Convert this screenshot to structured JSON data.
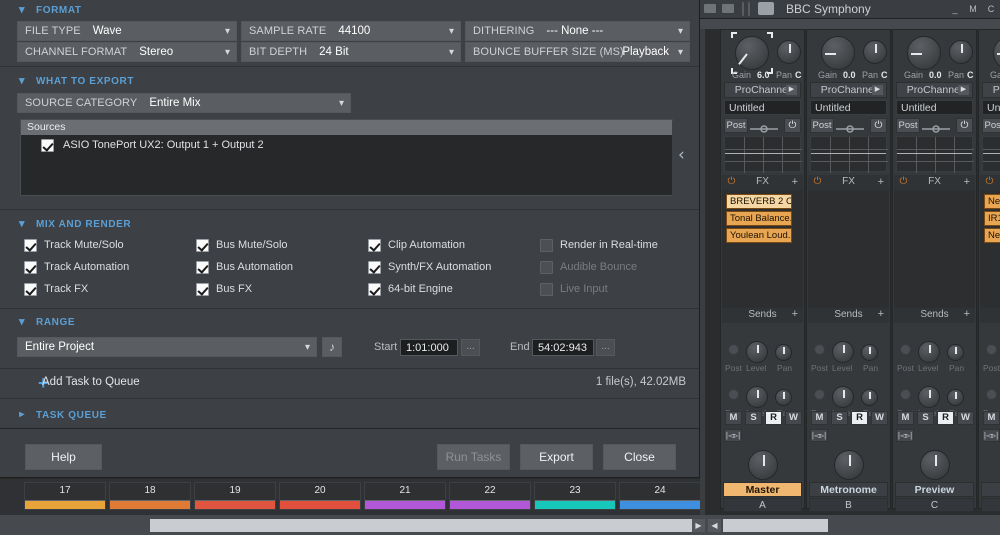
{
  "host": {
    "title": "BBC Symphony",
    "window_buttons": [
      "_",
      "M",
      "C"
    ]
  },
  "dialog": {
    "sections": {
      "format": {
        "title": "FORMAT",
        "fields": [
          {
            "label": "FILE TYPE",
            "value": "Wave"
          },
          {
            "label": "CHANNEL FORMAT",
            "value": "Stereo"
          },
          {
            "label": "SAMPLE RATE",
            "value": "44100"
          },
          {
            "label": "BIT DEPTH",
            "value": "24 Bit"
          },
          {
            "label": "DITHERING",
            "value": "--- None ---"
          },
          {
            "label": "BOUNCE BUFFER SIZE (MS)",
            "value": "Playback"
          }
        ]
      },
      "what_to_export": {
        "title": "WHAT TO EXPORT",
        "source_category": {
          "label": "SOURCE CATEGORY",
          "value": "Entire Mix"
        },
        "sources_header": "Sources",
        "sources": [
          {
            "label": "ASIO TonePort UX2: Output 1 + Output 2",
            "checked": true
          }
        ]
      },
      "mix_and_render": {
        "title": "MIX AND RENDER",
        "options": [
          {
            "label": "Track Mute/Solo",
            "checked": true,
            "enabled": true
          },
          {
            "label": "Track Automation",
            "checked": true,
            "enabled": true
          },
          {
            "label": "Track FX",
            "checked": true,
            "enabled": true
          },
          {
            "label": "Bus Mute/Solo",
            "checked": true,
            "enabled": true
          },
          {
            "label": "Bus Automation",
            "checked": true,
            "enabled": true
          },
          {
            "label": "Bus FX",
            "checked": true,
            "enabled": true
          },
          {
            "label": "Clip Automation",
            "checked": true,
            "enabled": true
          },
          {
            "label": "Synth/FX Automation",
            "checked": true,
            "enabled": true
          },
          {
            "label": "64-bit Engine",
            "checked": true,
            "enabled": true
          },
          {
            "label": "Render in Real-time",
            "checked": false,
            "enabled": true
          },
          {
            "label": "Audible Bounce",
            "checked": false,
            "enabled": false
          },
          {
            "label": "Live Input",
            "checked": false,
            "enabled": false
          }
        ]
      },
      "range": {
        "title": "RANGE",
        "preset": "Entire Project",
        "music_icon": "music-note-icon",
        "start_label": "Start",
        "start_value": "1:01:000",
        "end_label": "End",
        "end_value": "54:02:943",
        "ellipsis": "..."
      },
      "add_task": {
        "label": "Add Task to Queue",
        "plus": "+",
        "file_info": "1 file(s), 42.02MB"
      },
      "task_queue": {
        "title": "TASK QUEUE"
      }
    },
    "buttons": {
      "help": "Help",
      "run_tasks": "Run Tasks",
      "export": "Export",
      "close": "Close"
    },
    "collapse_arrow": "‹"
  },
  "clips": {
    "items": [
      {
        "num": "17",
        "color": "#e8a33a"
      },
      {
        "num": "18",
        "color": "#e07b35"
      },
      {
        "num": "19",
        "color": "#e0553f"
      },
      {
        "num": "20",
        "color": "#e0503c"
      },
      {
        "num": "21",
        "color": "#b157d8"
      },
      {
        "num": "22",
        "color": "#b157d8"
      },
      {
        "num": "23",
        "color": "#17c7ba"
      },
      {
        "num": "24",
        "color": "#3f8fe0"
      }
    ]
  },
  "mixer": {
    "labels": {
      "gain": "Gain",
      "pan": "Pan",
      "prochannel": "ProChannel",
      "untitled": "Untitled",
      "post": "Post",
      "fx": "FX",
      "sends": "Sends",
      "send_post": "Post",
      "send_level": "Level",
      "send_pan": "Pan",
      "plus": "+",
      "power": "⏻",
      "mute": "M",
      "solo": "S",
      "read": "R",
      "write": "W"
    },
    "strips": [
      {
        "gain": "6.0",
        "pan": "C",
        "selected": true,
        "fx": [
          "BREVERB 2 C...",
          "Tonal Balance...",
          "Youlean Loud..."
        ],
        "name": "Master",
        "letter": "A",
        "name_style": "master"
      },
      {
        "gain": "0.0",
        "pan": "C",
        "selected": false,
        "fx": [],
        "name": "Metronome",
        "letter": "B",
        "name_style": "plain"
      },
      {
        "gain": "0.0",
        "pan": "C",
        "selected": false,
        "fx": [],
        "name": "Preview",
        "letter": "C",
        "name_style": "plain"
      },
      {
        "gain": "",
        "pan": "",
        "selected": false,
        "fx": [
          "Neu...",
          "IR1",
          "Neu..."
        ],
        "name": "",
        "letter": "",
        "name_style": "plain"
      }
    ]
  },
  "colors": {
    "accent_blue": "#5b9fd4",
    "fx_orange": "#e8a552",
    "fx_orange_light": "#f5d7a4",
    "master_name": "#f0b771",
    "dialog_bg": "#3d4044",
    "field_bg": "#5a5d61"
  }
}
